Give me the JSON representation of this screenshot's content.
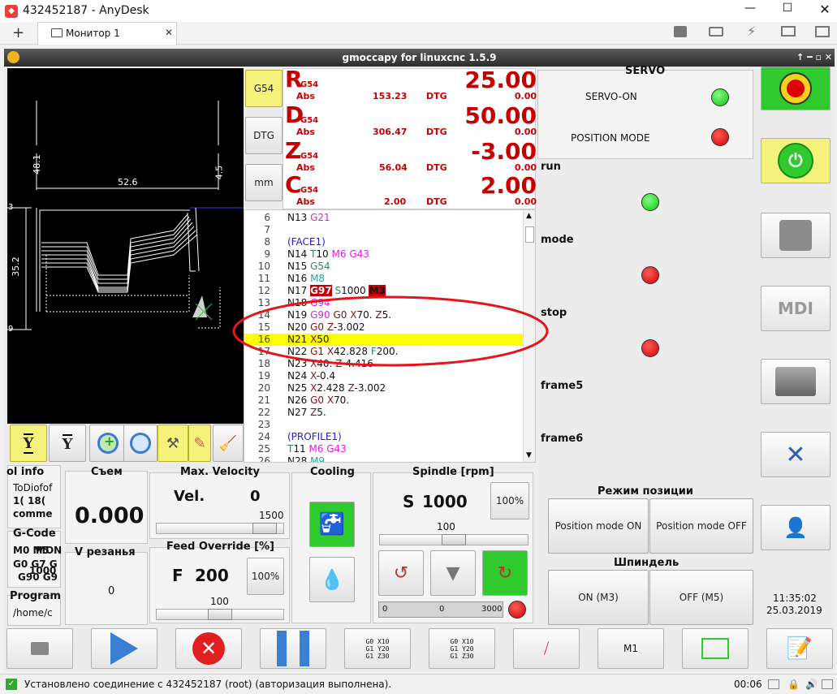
{
  "anydesk": {
    "title": "432452187 - AnyDesk",
    "tab": "Монитор 1",
    "add": "+",
    "status": "Установлено соединение с 432452187 (root) (авторизация выполнена).",
    "time": "00:06"
  },
  "app": {
    "title": "gmoccapy for linuxcnc  1.5.9"
  },
  "preview": {
    "dim_top": "52.6",
    "dim_left": "48.1",
    "dim_right": "4.5",
    "dim_side": "35.2",
    "tick_a": "3",
    "tick_b": "9"
  },
  "modes": {
    "g54": "G54",
    "dtg": "DTG",
    "mm": "mm"
  },
  "dro": [
    {
      "axis": "R",
      "coord": "G54",
      "abs_label": "Abs",
      "abs": "153.23",
      "dtg_label": "DTG",
      "value": "25.00",
      "dtg": "0.00"
    },
    {
      "axis": "D",
      "coord": "G54",
      "abs_label": "Abs",
      "abs": "306.47",
      "dtg_label": "DTG",
      "value": "50.00",
      "dtg": "0.00"
    },
    {
      "axis": "Z",
      "coord": "G54",
      "abs_label": "Abs",
      "abs": "56.04",
      "dtg_label": "DTG",
      "value": "-3.00",
      "dtg": "0.00"
    },
    {
      "axis": "C",
      "coord": "G54",
      "abs_label": "Abs",
      "abs": "2.00",
      "dtg_label": "DTG",
      "value": "2.00",
      "dtg": "0.00"
    }
  ],
  "gcode": [
    {
      "n": "6",
      "parts": [
        [
          "N13 ",
          "#111"
        ],
        [
          "G21",
          "#e020e0"
        ]
      ]
    },
    {
      "n": "7",
      "parts": []
    },
    {
      "n": "8",
      "parts": [
        [
          "(FACE1)",
          "#2020c8"
        ]
      ]
    },
    {
      "n": "9",
      "parts": [
        [
          "N14 ",
          "#111"
        ],
        [
          "T",
          "#2a8a5a"
        ],
        [
          "10 ",
          "#111"
        ],
        [
          "M6 ",
          "#e020e0"
        ],
        [
          "G43",
          "#e020e0"
        ]
      ]
    },
    {
      "n": "10",
      "parts": [
        [
          "N15 ",
          "#111"
        ],
        [
          "G54",
          "#2a8a5a"
        ]
      ]
    },
    {
      "n": "11",
      "parts": [
        [
          "N16 ",
          "#111"
        ],
        [
          "M8",
          "#2aa0a0"
        ]
      ]
    },
    {
      "n": "12",
      "parts": [
        [
          "N17 ",
          "#111"
        ],
        [
          "G97",
          "#fff",
          "#c00000"
        ],
        [
          " ",
          "#111"
        ],
        [
          "S",
          "#2a8a5a"
        ],
        [
          "1000 ",
          "#111"
        ],
        [
          "M3",
          "#111",
          "#c00000"
        ]
      ]
    },
    {
      "n": "13",
      "parts": [
        [
          "N18 ",
          "#111"
        ],
        [
          "G94",
          "#e020e0"
        ]
      ]
    },
    {
      "n": "14",
      "parts": [
        [
          "N19 ",
          "#111"
        ],
        [
          "G90 ",
          "#e020e0"
        ],
        [
          "G0 ",
          "#8a1010"
        ],
        [
          "X",
          "#8a1010"
        ],
        [
          "70. ",
          "#111"
        ],
        [
          "Z",
          "#8a1010"
        ],
        [
          "5.",
          "#111"
        ]
      ]
    },
    {
      "n": "15",
      "parts": [
        [
          "N20 ",
          "#111"
        ],
        [
          "G0 ",
          "#8a1010"
        ],
        [
          "Z",
          "#8a1010"
        ],
        [
          "-3.002",
          "#111"
        ]
      ]
    },
    {
      "n": "16",
      "parts": [
        [
          "N21 ",
          "#111"
        ],
        [
          "X",
          "#8a1010"
        ],
        [
          "50",
          "#111"
        ]
      ],
      "hl": true
    },
    {
      "n": "17",
      "parts": [
        [
          "N22 ",
          "#111"
        ],
        [
          "G1 ",
          "#8a1010"
        ],
        [
          "X",
          "#8a1010"
        ],
        [
          "42.828 ",
          "#111"
        ],
        [
          "F",
          "#2a8a5a"
        ],
        [
          "200.",
          "#111"
        ]
      ]
    },
    {
      "n": "18",
      "parts": [
        [
          "N23 ",
          "#111"
        ],
        [
          "X",
          "#8a1010"
        ],
        [
          "40. ",
          "#111"
        ],
        [
          "Z",
          "#8a1010"
        ],
        [
          "-4.416",
          "#111"
        ]
      ]
    },
    {
      "n": "19",
      "parts": [
        [
          "N24 ",
          "#111"
        ],
        [
          "X",
          "#8a1010"
        ],
        [
          "-0.4",
          "#111"
        ]
      ]
    },
    {
      "n": "20",
      "parts": [
        [
          "N25 ",
          "#111"
        ],
        [
          "X",
          "#8a1010"
        ],
        [
          "2.428 ",
          "#111"
        ],
        [
          "Z",
          "#8a1010"
        ],
        [
          "-3.002",
          "#111"
        ]
      ]
    },
    {
      "n": "21",
      "parts": [
        [
          "N26 ",
          "#111"
        ],
        [
          "G0 ",
          "#8a1010"
        ],
        [
          "X",
          "#8a1010"
        ],
        [
          "70.",
          "#111"
        ]
      ]
    },
    {
      "n": "22",
      "parts": [
        [
          "N27 ",
          "#111"
        ],
        [
          "Z",
          "#8a1010"
        ],
        [
          "5.",
          "#111"
        ]
      ]
    },
    {
      "n": "23",
      "parts": []
    },
    {
      "n": "24",
      "parts": [
        [
          "(PROFILE1)",
          "#2020c8"
        ]
      ]
    },
    {
      "n": "25",
      "parts": [
        [
          "T",
          "#2a8a5a"
        ],
        [
          "11 ",
          "#111"
        ],
        [
          "M6 ",
          "#e020e0"
        ],
        [
          "G43",
          "#e020e0"
        ]
      ]
    },
    {
      "n": "26",
      "parts": [
        [
          "N28 ",
          "#111"
        ],
        [
          "M9",
          "#2aa0a0"
        ]
      ]
    }
  ],
  "servo": {
    "title": "SERVO",
    "servo_on": "SERVO-ON",
    "position_mode": "POSITION MODE"
  },
  "status": {
    "run": "run",
    "mode": "mode",
    "stop": "stop",
    "frame5": "frame5",
    "frame6": "frame6"
  },
  "posmode": {
    "title": "Режим позиции",
    "on": "Position mode ON",
    "off": "Position mode OFF"
  },
  "spindle_box": {
    "title": "Шпиндель",
    "on": "ON (M3)",
    "off": "OFF (M5)"
  },
  "clock": {
    "time": "11:35:02",
    "date": "25.03.2019"
  },
  "tool_info": {
    "title": "ol info",
    "l1": "ToDiofof",
    "l2": "1( 18(",
    "l3": "comme"
  },
  "gcode_info": {
    "title": "G-Code",
    "l1": "M0 M5",
    "l1b": "MON",
    "l2": "G0 G7 G",
    "l3": "G90 G9",
    "l2b": "1000"
  },
  "program": {
    "title": "Program",
    "path": "/home/c"
  },
  "sjem": {
    "title": "Съем",
    "value": "0.000"
  },
  "vrez": {
    "title": "V резанья",
    "value": "0"
  },
  "velocity": {
    "title": "Max. Velocity",
    "label": "Vel.",
    "value": "0",
    "max": "1500",
    "knob_fraction": 0.94
  },
  "feed": {
    "title": "Feed Override [%]",
    "label": "F",
    "value": "200",
    "pct": "100%",
    "scale": "100",
    "knob_fraction": 0.5
  },
  "cooling": {
    "title": "Cooling"
  },
  "spindle": {
    "title": "Spindle [rpm]",
    "label": "S",
    "value": "1000",
    "pct": "100%",
    "scale": "100",
    "knob_fraction": 0.5,
    "bar_min": "0",
    "bar_val": "0",
    "bar_max": "3000"
  },
  "toolbar": {
    "m1": "M1",
    "g_a": "G0 X10",
    "g_b": "G1 Y20",
    "g_c": "G1 Z30"
  },
  "colors": {
    "accent_green": "#2eca2e",
    "yellow": "#f4f27a",
    "dro_red": "#c40000"
  }
}
